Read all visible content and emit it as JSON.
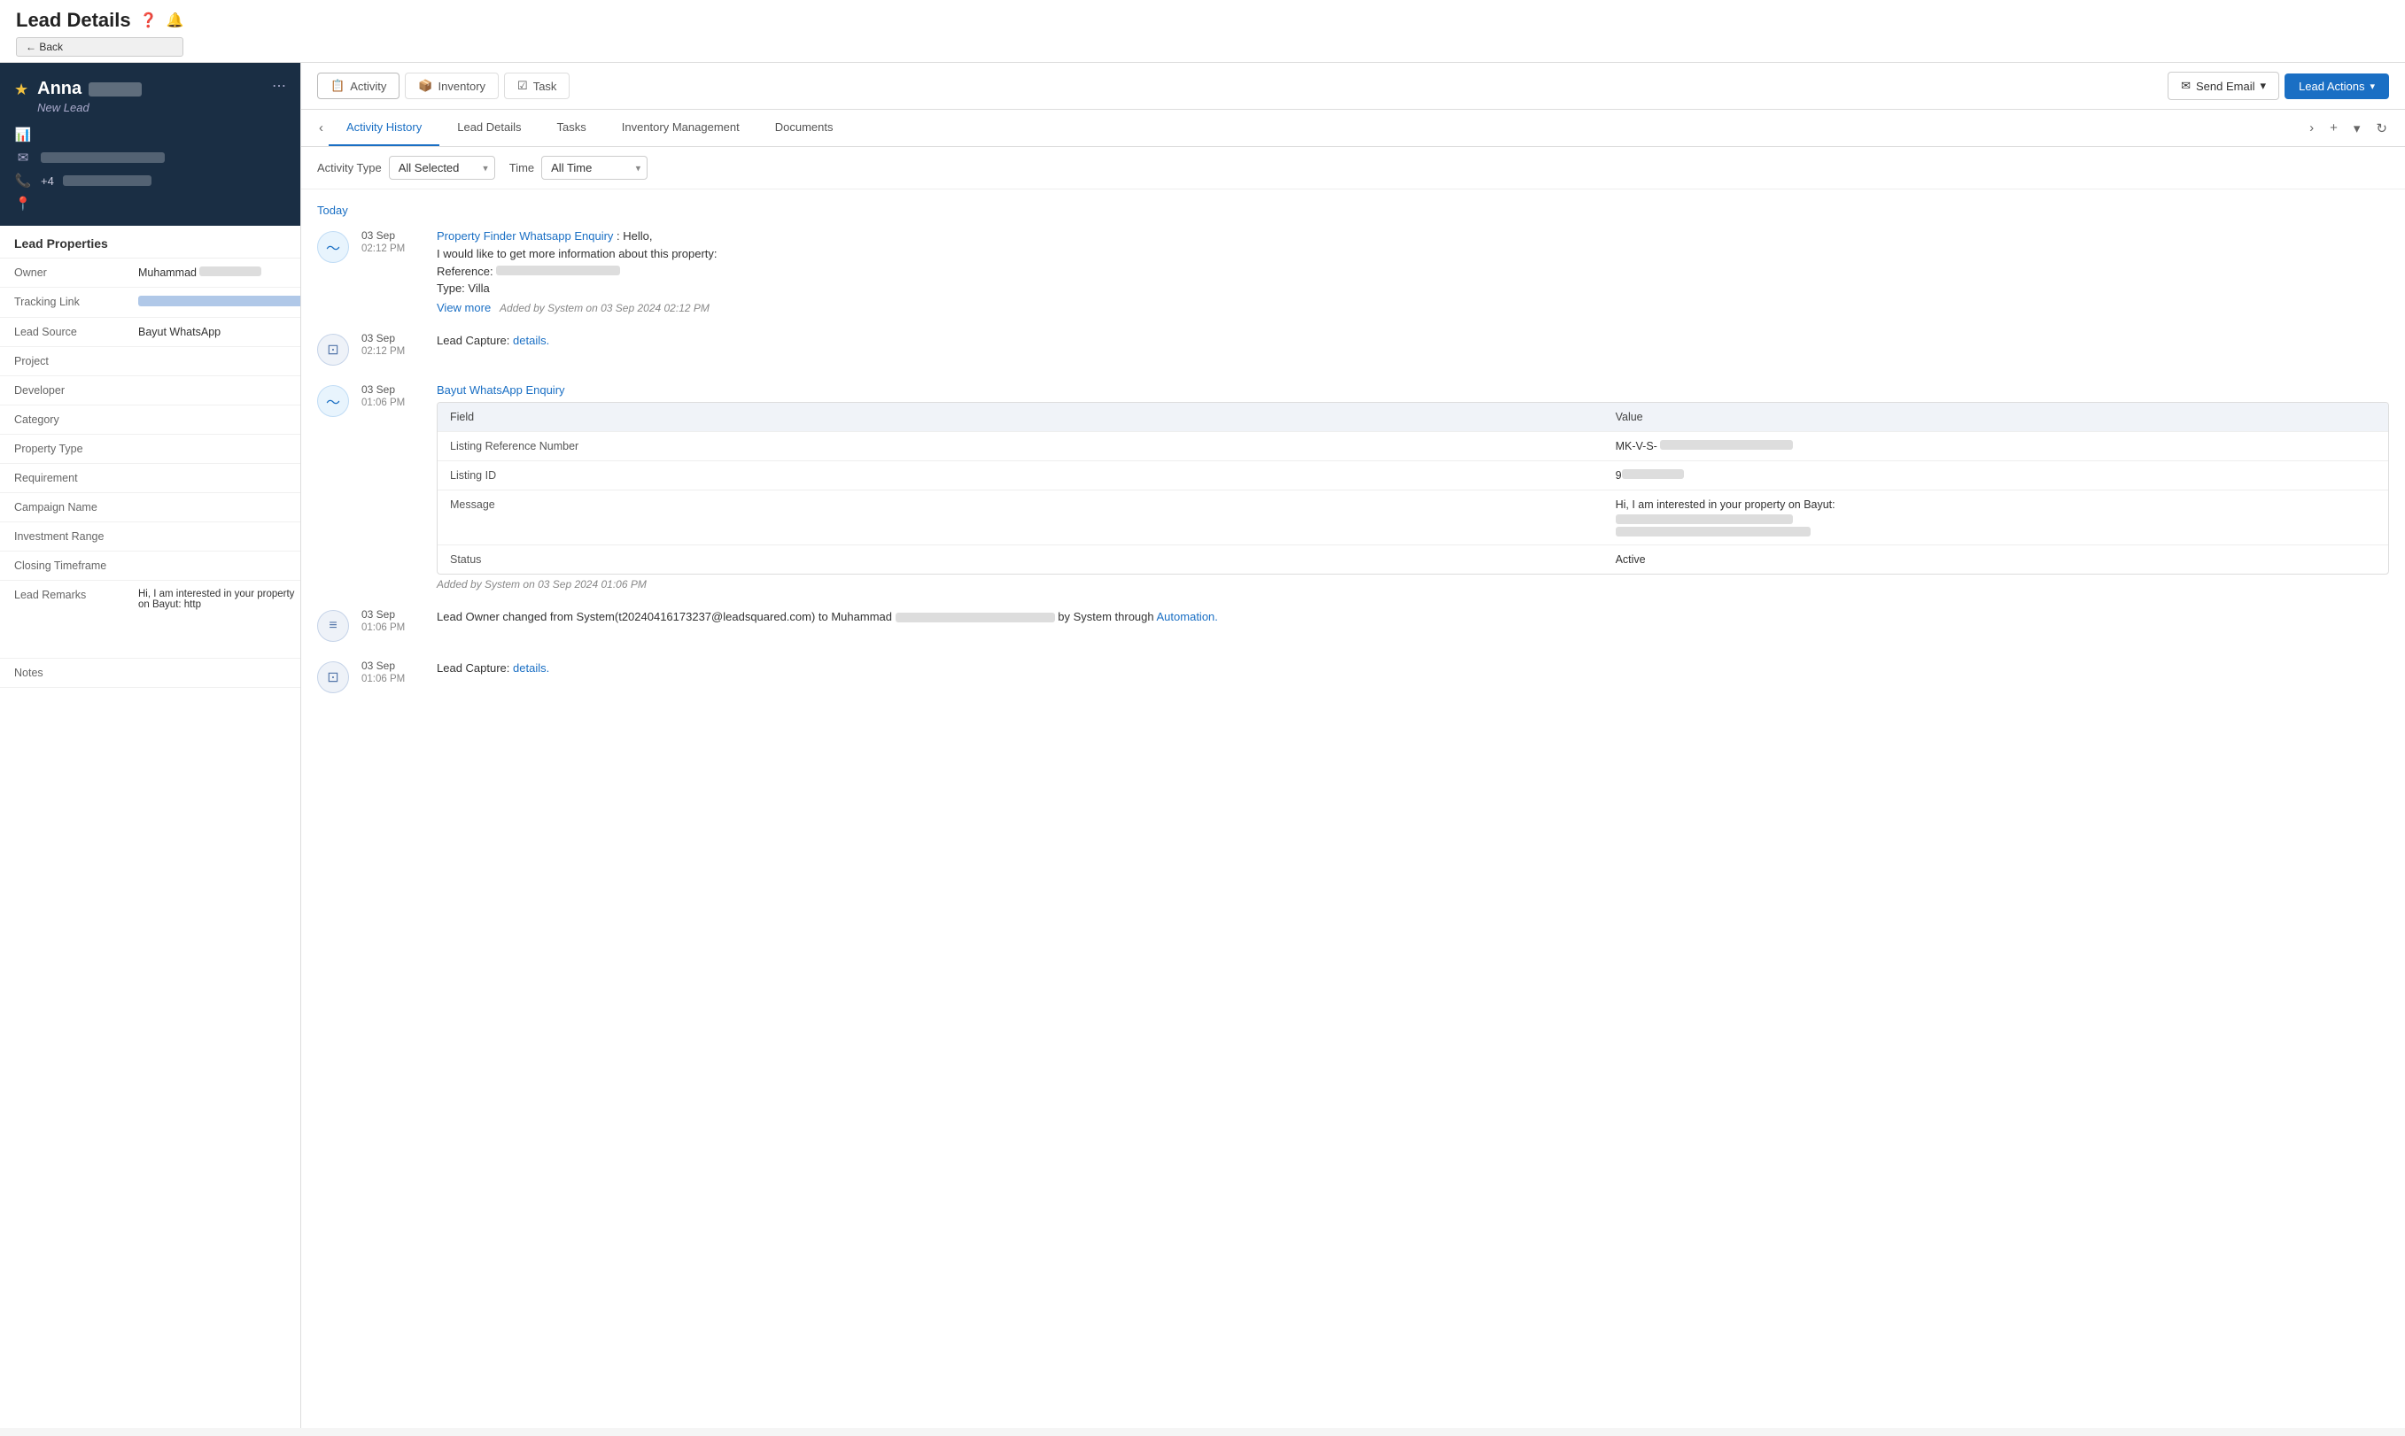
{
  "page": {
    "title": "Lead Details",
    "help_icon": "❓",
    "bell_icon": "🔔",
    "back_label": "← Back"
  },
  "lead_card": {
    "star": "★",
    "name": "Anna",
    "status": "New Lead",
    "share_icon": "⋯",
    "info_rows": [
      {
        "icon": "📊",
        "type": "chart"
      },
      {
        "icon": "✉",
        "type": "email"
      },
      {
        "icon": "📞",
        "value": "+4"
      },
      {
        "icon": "📍",
        "type": "location"
      }
    ]
  },
  "lead_properties": {
    "header": "Lead Properties",
    "rows": [
      {
        "label": "Owner",
        "value": "Muhammad",
        "blur": true
      },
      {
        "label": "Tracking Link",
        "value": "",
        "isLink": true
      },
      {
        "label": "Lead Source",
        "value": "Bayut WhatsApp"
      },
      {
        "label": "Project",
        "value": ""
      },
      {
        "label": "Developer",
        "value": ""
      },
      {
        "label": "Category",
        "value": ""
      },
      {
        "label": "Property Type",
        "value": ""
      },
      {
        "label": "Requirement",
        "value": ""
      },
      {
        "label": "Campaign Name",
        "value": ""
      },
      {
        "label": "Investment Range",
        "value": ""
      },
      {
        "label": "Closing Timeframe",
        "value": ""
      },
      {
        "label": "Lead Remarks",
        "value": "Hi, I am interested in your property on Bayut: http",
        "hasBlur": true
      },
      {
        "label": "Notes",
        "value": ""
      }
    ]
  },
  "toolbar": {
    "tabs": [
      {
        "label": "Activity",
        "icon": "📋",
        "active": true
      },
      {
        "label": "Inventory",
        "icon": "📦",
        "active": false
      },
      {
        "label": "Task",
        "icon": "☑",
        "active": false
      }
    ],
    "send_email_label": "Send Email",
    "lead_actions_label": "Lead Actions"
  },
  "sub_tabs": {
    "tabs": [
      {
        "label": "Activity History",
        "active": true
      },
      {
        "label": "Lead Details",
        "active": false
      },
      {
        "label": "Tasks",
        "active": false
      },
      {
        "label": "Inventory Management",
        "active": false
      },
      {
        "label": "Documents",
        "active": false
      }
    ],
    "nav_prev": "‹",
    "nav_next": "›",
    "nav_add": "+",
    "nav_dropdown": "▾",
    "nav_refresh": "↻"
  },
  "filters": {
    "activity_type_label": "Activity Type",
    "activity_type_value": "All Selected",
    "time_label": "Time",
    "time_value": "All Time"
  },
  "activity": {
    "day_label": "Today",
    "items": [
      {
        "id": "item1",
        "icon_type": "activity",
        "icon": "〜",
        "date": "03 Sep",
        "time": "02:12 PM",
        "title": "Property Finder Whatsapp Enquiry",
        "title_suffix": ": Hello,",
        "lines": [
          "I would like to get more information about this property:",
          "Reference: [blurred]",
          "Type: Villa"
        ],
        "view_more": "View more",
        "added": "Added by System on 03 Sep 2024 02:12 PM",
        "has_table": false
      },
      {
        "id": "item2",
        "icon_type": "capture",
        "icon": "⊡",
        "date": "03 Sep",
        "time": "02:12 PM",
        "text": "Lead Capture: ",
        "capture_link": "details.",
        "has_table": false
      },
      {
        "id": "item3",
        "icon_type": "activity",
        "icon": "〜",
        "date": "03 Sep",
        "time": "01:06 PM",
        "title": "Bayut WhatsApp Enquiry",
        "has_table": true,
        "table_rows": [
          {
            "field": "Listing Reference Number",
            "value": "MK-V-S-",
            "value_blur": true
          },
          {
            "field": "Listing ID",
            "value": "9",
            "value_blur": true
          },
          {
            "field": "Message",
            "value": "Hi, I am interested in your property on Bayut:",
            "value_blur": true
          },
          {
            "field": "Status",
            "value": "Active",
            "value_blur": false
          }
        ],
        "added": "Added by System on 03 Sep 2024 01:06 PM"
      },
      {
        "id": "item4",
        "icon_type": "owner",
        "icon": "≡",
        "date": "03 Sep",
        "time": "01:06 PM",
        "is_owner_change": true,
        "owner_text_prefix": "Lead Owner changed from System(t20240416173237@leadsquared.com) to Muhammad",
        "owner_suffix": "by System through",
        "automation_link": "Automation.",
        "has_table": false
      },
      {
        "id": "item5",
        "icon_type": "capture",
        "icon": "⊡",
        "date": "03 Sep",
        "time": "01:06 PM",
        "text": "Lead Capture: ",
        "capture_link": "details.",
        "has_table": false
      }
    ]
  }
}
